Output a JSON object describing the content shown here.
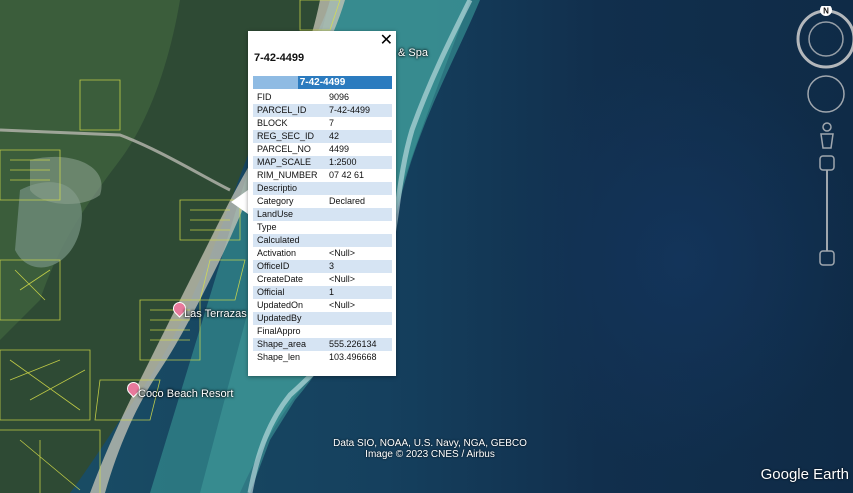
{
  "map": {
    "labels": {
      "spa": "& Spa",
      "las_terrazas": "Las Terrazas",
      "coco_beach": "Coco Beach Resort"
    },
    "attribution": {
      "line1": "Data SIO, NOAA, U.S. Navy, NGA, GEBCO",
      "line2": "Image © 2023 CNES / Airbus"
    },
    "logo": "Google Earth",
    "compass_letter": "N"
  },
  "popup": {
    "title": "7-42-4499",
    "header": "7-42-4499",
    "close_label": "✕",
    "rows": [
      {
        "key": "FID",
        "value": "9096"
      },
      {
        "key": "PARCEL_ID",
        "value": "7-42-4499"
      },
      {
        "key": "BLOCK",
        "value": "7"
      },
      {
        "key": "REG_SEC_ID",
        "value": "42"
      },
      {
        "key": "PARCEL_NO",
        "value": "4499"
      },
      {
        "key": "MAP_SCALE",
        "value": "1:2500"
      },
      {
        "key": "RIM_NUMBER",
        "value": "07 42 61"
      },
      {
        "key": "Descriptio",
        "value": ""
      },
      {
        "key": "Category",
        "value": "Declared"
      },
      {
        "key": "LandUse",
        "value": ""
      },
      {
        "key": "Type",
        "value": ""
      },
      {
        "key": "Calculated",
        "value": ""
      },
      {
        "key": "Activation",
        "value": "<Null>"
      },
      {
        "key": "OfficeID",
        "value": "3"
      },
      {
        "key": "CreateDate",
        "value": "<Null>"
      },
      {
        "key": "Official",
        "value": "1"
      },
      {
        "key": "UpdatedOn",
        "value": "<Null>"
      },
      {
        "key": "UpdatedBy",
        "value": ""
      },
      {
        "key": "FinalAppro",
        "value": ""
      },
      {
        "key": "Shape_area",
        "value": "555.226134"
      },
      {
        "key": "Shape_len",
        "value": "103.496668"
      }
    ]
  }
}
